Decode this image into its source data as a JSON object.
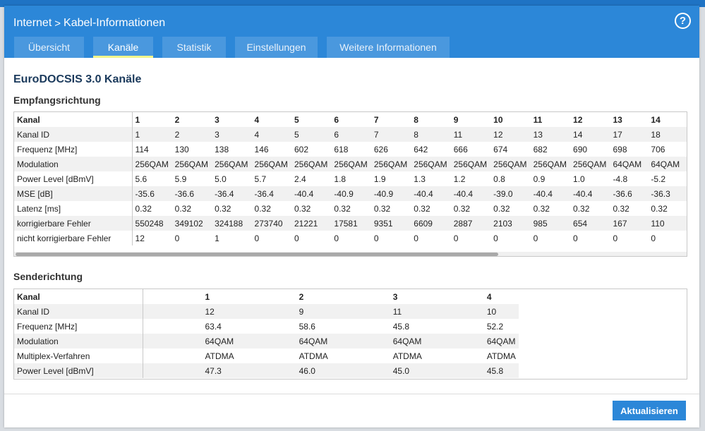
{
  "breadcrumb": {
    "parent": "Internet",
    "separator": ">",
    "current": "Kabel-Informationen"
  },
  "help": {
    "label": "?"
  },
  "tabs": [
    {
      "label": "Übersicht"
    },
    {
      "label": "Kanäle"
    },
    {
      "label": "Statistik"
    },
    {
      "label": "Einstellungen"
    },
    {
      "label": "Weitere Informationen"
    }
  ],
  "active_tab": "Kanäle",
  "section_title": "EuroDOCSIS 3.0 Kanäle",
  "downstream": {
    "title": "Empfangsrichtung",
    "rows": [
      {
        "label": "Kanal",
        "cells": [
          "1",
          "2",
          "3",
          "4",
          "5",
          "6",
          "7",
          "8",
          "9",
          "10",
          "11",
          "12",
          "13",
          "14"
        ]
      },
      {
        "label": "Kanal ID",
        "cells": [
          "1",
          "2",
          "3",
          "4",
          "5",
          "6",
          "7",
          "8",
          "11",
          "12",
          "13",
          "14",
          "17",
          "18"
        ]
      },
      {
        "label": "Frequenz [MHz]",
        "cells": [
          "114",
          "130",
          "138",
          "146",
          "602",
          "618",
          "626",
          "642",
          "666",
          "674",
          "682",
          "690",
          "698",
          "706"
        ]
      },
      {
        "label": "Modulation",
        "cells": [
          "256QAM",
          "256QAM",
          "256QAM",
          "256QAM",
          "256QAM",
          "256QAM",
          "256QAM",
          "256QAM",
          "256QAM",
          "256QAM",
          "256QAM",
          "256QAM",
          "64QAM",
          "64QAM"
        ]
      },
      {
        "label": "Power Level [dBmV]",
        "cells": [
          "5.6",
          "5.9",
          "5.0",
          "5.7",
          "2.4",
          "1.8",
          "1.9",
          "1.3",
          "1.2",
          "0.8",
          "0.9",
          "1.0",
          "-4.8",
          "-5.2"
        ]
      },
      {
        "label": "MSE [dB]",
        "cells": [
          "-35.6",
          "-36.6",
          "-36.4",
          "-36.4",
          "-40.4",
          "-40.9",
          "-40.9",
          "-40.4",
          "-40.4",
          "-39.0",
          "-40.4",
          "-40.4",
          "-36.6",
          "-36.3"
        ]
      },
      {
        "label": "Latenz [ms]",
        "cells": [
          "0.32",
          "0.32",
          "0.32",
          "0.32",
          "0.32",
          "0.32",
          "0.32",
          "0.32",
          "0.32",
          "0.32",
          "0.32",
          "0.32",
          "0.32",
          "0.32"
        ]
      },
      {
        "label": "korrigierbare Fehler",
        "cells": [
          "550248",
          "349102",
          "324188",
          "273740",
          "21221",
          "17581",
          "9351",
          "6609",
          "2887",
          "2103",
          "985",
          "654",
          "167",
          "110"
        ]
      },
      {
        "label": "nicht korrigierbare Fehler",
        "cells": [
          "12",
          "0",
          "1",
          "0",
          "0",
          "0",
          "0",
          "0",
          "0",
          "0",
          "0",
          "0",
          "0",
          "0"
        ]
      }
    ],
    "scroll_position": 0.7
  },
  "upstream": {
    "title": "Senderichtung",
    "rows": [
      {
        "label": "Kanal",
        "cells": [
          "1",
          "2",
          "3",
          "4"
        ]
      },
      {
        "label": "Kanal ID",
        "cells": [
          "12",
          "9",
          "11",
          "10"
        ]
      },
      {
        "label": "Frequenz [MHz]",
        "cells": [
          "63.4",
          "58.6",
          "45.8",
          "52.2"
        ]
      },
      {
        "label": "Modulation",
        "cells": [
          "64QAM",
          "64QAM",
          "64QAM",
          "64QAM"
        ]
      },
      {
        "label": "Multiplex-Verfahren",
        "cells": [
          "ATDMA",
          "ATDMA",
          "ATDMA",
          "ATDMA"
        ]
      },
      {
        "label": "Power Level [dBmV]",
        "cells": [
          "47.3",
          "46.0",
          "45.0",
          "45.8"
        ]
      }
    ]
  },
  "refresh_label": "Aktualisieren",
  "colors": {
    "header": "#2c87d8",
    "tab": "#4a98de",
    "tab_underline": "#f2f58a",
    "button": "#2c87d8",
    "title": "#1b3a5c"
  }
}
